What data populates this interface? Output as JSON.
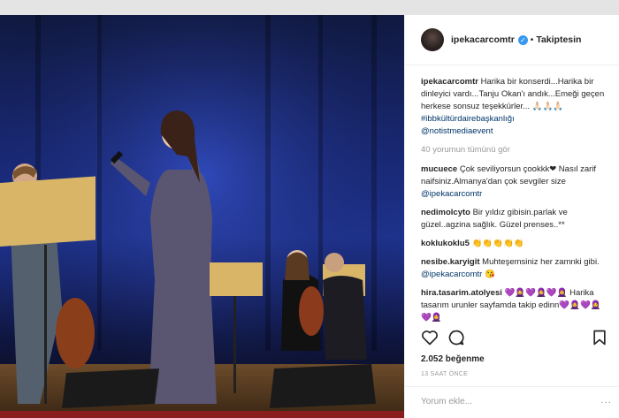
{
  "post": {
    "username": "ipekacarcomtr",
    "follow_label": "Takiptesin",
    "separator": "•",
    "caption_user": "ipekacarcomtr",
    "caption_text": "Harika bir konserdi...Harika bir dinleyici vardı...Tanju Okan'ı andık...Emeği geçen herkese sonsuz teşekkürler... 🙏🏻🙏🏻🙏🏻",
    "hashtag": "#ibbkültürdairebaşkanlığı",
    "mention": "@notistmediaevent",
    "view_all_comments": "40 yorumun tümünü gör",
    "comments": [
      {
        "user": "mucuece",
        "text": "Çok seviliyorsun çookkk❤ Nasıl zarif naifsiniz.Almanya'dan çok sevgiler size",
        "mention": "@ipekacarcomtr"
      },
      {
        "user": "nedimolcyto",
        "text": "Bir yıldız gibisin.parlak ve güzel..agzina sağlık. Güzel prenses..**",
        "mention": ""
      },
      {
        "user": "koklukoklu5",
        "text": "👏👏👏👏👏",
        "mention": ""
      },
      {
        "user": "nesibe.karyigit",
        "text": "Muhteşemsiniz her zamnki gibi.",
        "mention": "@ipekacarcomtr 😘"
      },
      {
        "user": "hira.tasarim.atolyesi",
        "text": "💜🧕💜🧕💜🧕 Harika tasarım urunler sayfamda takip edinn💜🧕💜🧕💜🧕",
        "mention": ""
      }
    ],
    "likes": "2.052 beğenme",
    "timestamp": "13 SAAT ÖNCE",
    "add_comment_placeholder": "Yorum ekle...",
    "more_options": "..."
  },
  "icons": {
    "like": "heart-icon",
    "comment": "comment-icon",
    "save": "bookmark-icon",
    "verified": "verified-badge-icon"
  },
  "colors": {
    "link": "#003569",
    "verified": "#3897f0",
    "muted": "#999999"
  }
}
